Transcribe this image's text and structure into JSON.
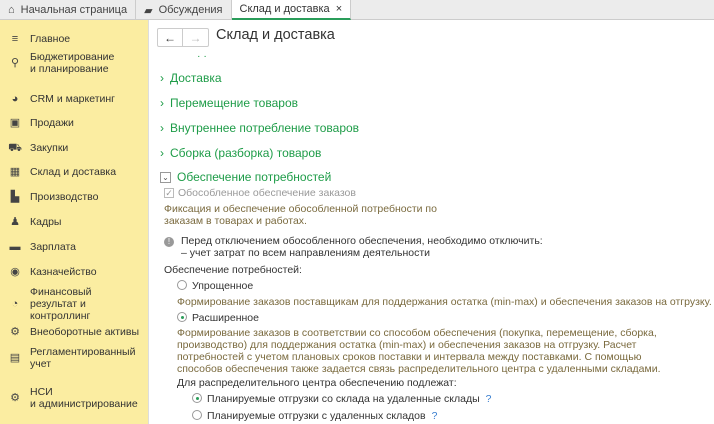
{
  "tabs": [
    {
      "label": "Начальная страница",
      "icon": "home-icon"
    },
    {
      "label": "Обсуждения",
      "icon": "chat-icon"
    },
    {
      "label": "Склад и доставка",
      "close": "×"
    }
  ],
  "sidebar": {
    "items": [
      {
        "label": "Главное",
        "icon": "≡"
      },
      {
        "label": "Бюджетирование\nи планирование",
        "icon": "⚲"
      },
      {
        "label": "CRM и маркетинг",
        "icon": "◕"
      },
      {
        "label": "Продажи",
        "icon": "▣"
      },
      {
        "label": "Закупки",
        "icon": "⛟"
      },
      {
        "label": "Склад и доставка",
        "icon": "▦"
      },
      {
        "label": "Производство",
        "icon": "▙"
      },
      {
        "label": "Кадры",
        "icon": "♟"
      },
      {
        "label": "Зарплата",
        "icon": "▬"
      },
      {
        "label": "Казначейство",
        "icon": "◉"
      },
      {
        "label": "Финансовый\nрезультат и контроллинг",
        "icon": "◔"
      },
      {
        "label": "Внеоборотные активы",
        "icon": "⚙"
      },
      {
        "label": "Регламентированный\nучет",
        "icon": "▤"
      },
      {
        "label": "НСИ\nи администрирование",
        "icon": "⚙"
      }
    ]
  },
  "header": {
    "back": "←",
    "forward": "→",
    "title": "Склад и доставка"
  },
  "sections": [
    "Доставка",
    "Перемещение товаров",
    "Внутреннее потребление товаров",
    "Сборка (разборка) товаров",
    "Обеспечение потребностей"
  ],
  "content": {
    "checkbox_label": "Обособленное обеспечение заказов",
    "checkbox_desc": "Фиксация и обеспечение обособленной потребности по\nзаказам в товарах и работах.",
    "info_line1": "Перед отключением обособленного обеспечения, необходимо отключить:",
    "info_line2": "– учет затрат по всем направлениям деятельности",
    "needs_label": "Обеспечение потребностей:",
    "opt1": "Упрощенное",
    "opt1_desc": "Формирование заказов поставщикам для поддержания остатка (min-max) и обеспечения заказов на отгрузку.",
    "opt2": "Расширенное",
    "opt2_desc": "Формирование заказов в соответствии со способом обеспечения (покупка, перемещение, сборка, производство) для поддержания остатка (min-max) и обеспечения заказов на отгрузку. Расчет потребностей с учетом плановых сроков поставки и интервала между поставками. С помощью способов обеспечения также задается связь распределительного центра с удаленными складами.",
    "dc_label": "Для распределительного центра обеспечению подлежат:",
    "dc_opt1": "Планируемые отгрузки со склада на удаленные склады",
    "dc_opt2": "Планируемые отгрузки с удаленных складов",
    "help": "?"
  }
}
